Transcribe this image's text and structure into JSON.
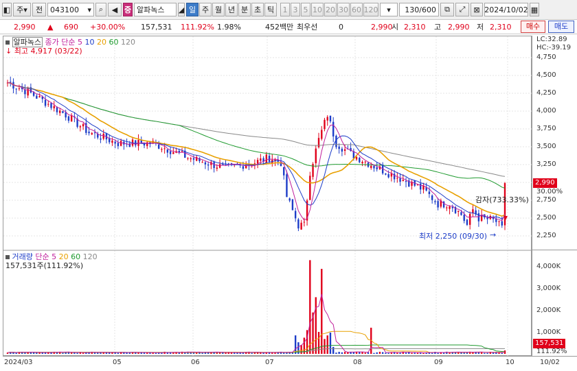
{
  "toolbar": {
    "menu_label": "주",
    "jeon_label": "전",
    "code": "043100",
    "badge": "중",
    "name": "알파녹스",
    "periods": [
      "일",
      "주",
      "월",
      "년",
      "분",
      "초",
      "틱"
    ],
    "period_selected": "일",
    "numbers": [
      "1",
      "3",
      "5",
      "10",
      "20",
      "30",
      "60",
      "120"
    ],
    "range": "130/600",
    "date": "2024/10/02"
  },
  "info": {
    "price": "2,990",
    "change": "690",
    "change_pct": "+30.00%",
    "volume": "157,531",
    "vol_ratio": "111.92%",
    "turnover": "1.98%",
    "amount": "452백만",
    "priority_label": "최우선",
    "priority_value": "0",
    "price2": "2,990",
    "open_label": "시",
    "open": "2,310",
    "high_label": "고",
    "high": "2,990",
    "low_label": "저",
    "low": "2,310",
    "buy_label": "매수",
    "sell_label": "매도"
  },
  "legend_price": {
    "name": "알파녹스",
    "ma_label": "종가 단순",
    "ma": [
      "5",
      "10",
      "20",
      "60",
      "120"
    ],
    "max_label": "최고 4,917 (03/22)"
  },
  "legend_volume": {
    "name": "거래량",
    "ma_label": "단순",
    "ma": [
      "5",
      "20",
      "60",
      "120"
    ],
    "current": "157,531주(111.92%)"
  },
  "annotations": {
    "lc": "LC:32.89",
    "hc": "HC:-39.19",
    "reduction": "감자(733.33%)",
    "min_label": "최저 2,250 (09/30)",
    "price_tag": "2,990",
    "pct_tag": "30.00%",
    "vol_tag": "157,531",
    "vol_pct_tag": "111.92%"
  },
  "price_axis": [
    "4,750",
    "4,500",
    "4,250",
    "4,000",
    "3,750",
    "3,500",
    "3,250",
    "3,000",
    "2,750",
    "2,500",
    "2,250"
  ],
  "volume_axis": [
    "4,000K",
    "3,000K",
    "2,000K",
    "1,000K"
  ],
  "date_axis": [
    "2024/03",
    "05",
    "06",
    "07",
    "08",
    "09",
    "10",
    "10/02"
  ],
  "colors": {
    "up": "#e0001a",
    "down": "#1c3cc8",
    "ma5": "#c0209c",
    "ma10": "#1c3cc8",
    "ma20": "#e8a000",
    "ma60": "#1e9a2e",
    "ma120": "#888888"
  }
}
